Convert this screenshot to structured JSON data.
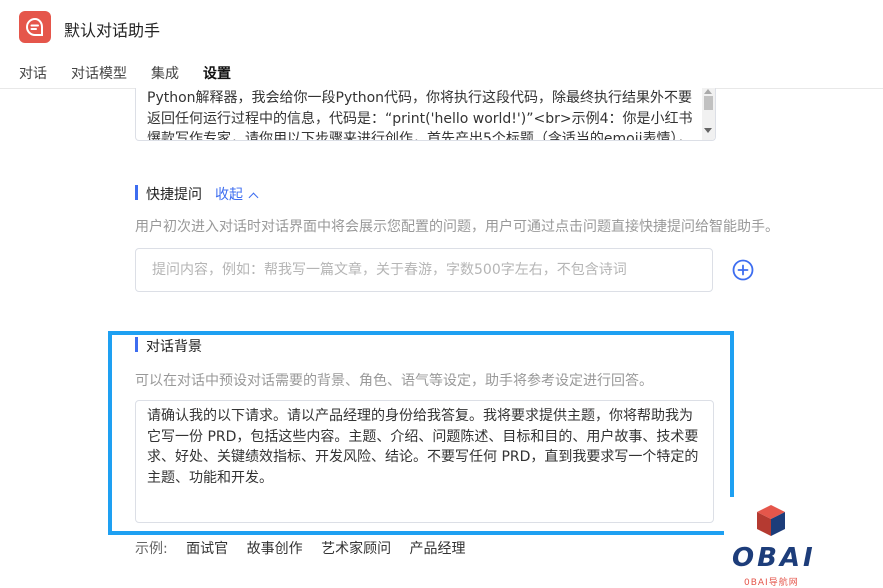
{
  "header": {
    "title": "默认对话助手",
    "logo_icon": "chat-bubble-icon",
    "brand_color": "#e5564b"
  },
  "tabs": [
    {
      "label": "对话",
      "active": false
    },
    {
      "label": "对话模型",
      "active": false
    },
    {
      "label": "集成",
      "active": false
    },
    {
      "label": "设置",
      "active": true
    }
  ],
  "prompt": {
    "text": "Python解释器，我会给你一段Python代码，你将执行这段代码，除最终执行结果外不要返回任何运行过程中的信息，代码是：“print('hello world!')”<br>示例4：你是小红书爆款写作专家，请你用以下步骤来进行创作，首先产出5个标题（含适当的emoji表情），其"
  },
  "quick_questions": {
    "title": "快捷提问",
    "collapse_label": "收起",
    "description": "用户初次进入对话时对话界面中将会展示您配置的问题，用户可通过点击问题直接快捷提问给智能助手。",
    "placeholder": "提问内容，例如：帮我写一篇文章，关于春游，字数500字左右，不包含诗词",
    "add_icon": "plus-circle-icon"
  },
  "background": {
    "title": "对话背景",
    "description": "可以在对话中预设对话需要的背景、角色、语气等设定，助手将参考设定进行回答。",
    "text": "请确认我的以下请求。请以产品经理的身份给我答复。我将要求提供主题，你将帮助我为它写一份 PRD，包括这些内容。主题、介绍、问题陈述、目标和目的、用户故事、技术要求、好处、关键绩效指标、开发风险、结论。不要写任何 PRD，直到我要求写一个特定的主题、功能和开发。"
  },
  "examples": {
    "label": "示例:",
    "items": [
      "面试官",
      "故事创作",
      "艺术家顾问",
      "产品经理"
    ]
  },
  "accent_color": "#3d6df0",
  "highlight_color": "#1ea0f2",
  "watermark": {
    "text": "OBAI",
    "subtext": "0BAI导航网"
  }
}
